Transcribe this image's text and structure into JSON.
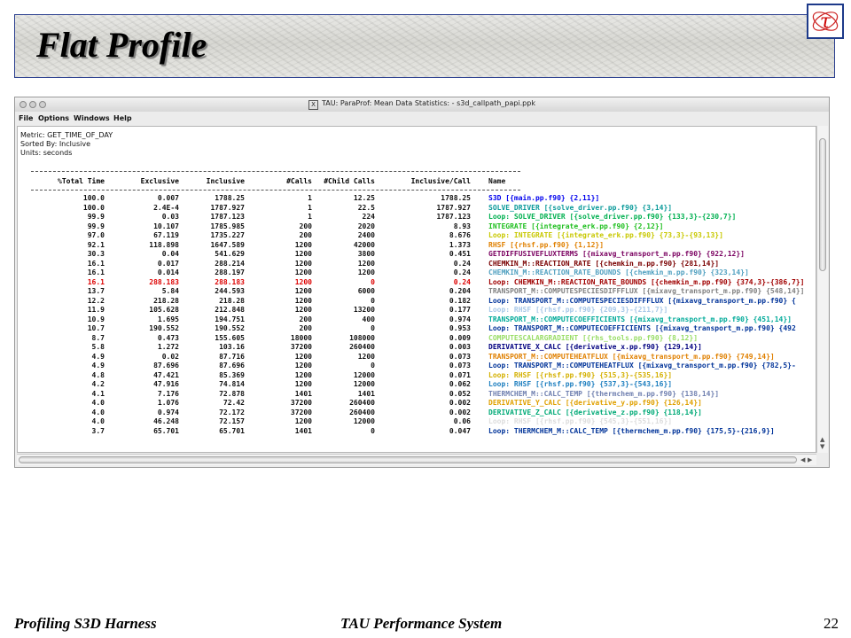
{
  "slide": {
    "title": "Flat Profile",
    "logo_glyph": "τ",
    "footer_left": "Profiling S3D Harness",
    "footer_center": "TAU Performance System",
    "page_number": "22"
  },
  "window": {
    "title": "TAU: ParaProf: Mean Data Statistics: - s3d_callpath_papi.ppk",
    "title_icon": "X",
    "menu": [
      "File",
      "Options",
      "Windows",
      "Help"
    ]
  },
  "meta": {
    "metric": "Metric: GET_TIME_OF_DAY",
    "sorted_by": "Sorted By: Inclusive",
    "units": "Units: seconds"
  },
  "table": {
    "headers": [
      "%Total Time",
      "Exclusive",
      "Inclusive",
      "#Calls",
      "#Child Calls",
      "Inclusive/Call",
      "Name"
    ],
    "rows": [
      {
        "total": "100.0",
        "exclusive": "0.007",
        "inclusive": "1788.25",
        "calls": "1",
        "child_calls": "12.25",
        "incl_per_call": "1788.25",
        "name": "S3D [{main.pp.f90} {2,11}]",
        "color": "#0000ee"
      },
      {
        "total": "100.0",
        "exclusive": "2.4E-4",
        "inclusive": "1787.927",
        "calls": "1",
        "child_calls": "22.5",
        "incl_per_call": "1787.927",
        "name": "SOLVE_DRIVER [{solve_driver.pp.f90} {3,14}]",
        "color": "#0a9a9a"
      },
      {
        "total": "99.9",
        "exclusive": "0.03",
        "inclusive": "1787.123",
        "calls": "1",
        "child_calls": "224",
        "incl_per_call": "1787.123",
        "name": "Loop: SOLVE_DRIVER [{solve_driver.pp.f90} {133,3}-{230,7}]",
        "color": "#00b050"
      },
      {
        "total": "99.9",
        "exclusive": "10.107",
        "inclusive": "1785.985",
        "calls": "200",
        "child_calls": "2020",
        "incl_per_call": "8.93",
        "name": "INTEGRATE [{integrate_erk.pp.f90} {2,12}]",
        "color": "#1fbf1f"
      },
      {
        "total": "97.0",
        "exclusive": "67.119",
        "inclusive": "1735.227",
        "calls": "200",
        "child_calls": "2400",
        "incl_per_call": "8.676",
        "name": "Loop: INTEGRATE [{integrate_erk.pp.f90} {73,3}-{93,13}]",
        "color": "#c8c800"
      },
      {
        "total": "92.1",
        "exclusive": "118.898",
        "inclusive": "1647.589",
        "calls": "1200",
        "child_calls": "42000",
        "incl_per_call": "1.373",
        "name": "RHSF [{rhsf.pp.f90} {1,12}]",
        "color": "#e08000"
      },
      {
        "total": "30.3",
        "exclusive": "0.04",
        "inclusive": "541.629",
        "calls": "1200",
        "child_calls": "3800",
        "incl_per_call": "0.451",
        "name": "GETDIFFUSIVEFLUXTERMS [{mixavg_transport_m.pp.f90} {922,12}]",
        "color": "#7a0060"
      },
      {
        "total": "16.1",
        "exclusive": "0.017",
        "inclusive": "288.214",
        "calls": "1200",
        "child_calls": "1200",
        "incl_per_call": "0.24",
        "name": "CHEMKIN_M::REACTION_RATE [{chemkin_m.pp.f90} {281,14}]",
        "color": "#7a0000"
      },
      {
        "total": "16.1",
        "exclusive": "0.014",
        "inclusive": "288.197",
        "calls": "1200",
        "child_calls": "1200",
        "incl_per_call": "0.24",
        "name": "CHEMKIN_M::REACTION_RATE_BOUNDS [{chemkin_m.pp.f90} {323,14}]",
        "color": "#50a0c0"
      },
      {
        "total": "16.1",
        "exclusive": "288.183",
        "inclusive": "288.183",
        "calls": "1200",
        "child_calls": "0",
        "incl_per_call": "0.24",
        "name": "Loop: CHEMKIN_M::REACTION_RATE_BOUNDS [{chemkin_m.pp.f90} {374,3}-{386,7}]",
        "color": "#a00000",
        "highlight": true
      },
      {
        "total": "13.7",
        "exclusive": "5.84",
        "inclusive": "244.593",
        "calls": "1200",
        "child_calls": "6000",
        "incl_per_call": "0.204",
        "name": "TRANSPORT_M::COMPUTESPECIESDIFFFLUX [{mixavg_transport_m.pp.f90} {548,14}]",
        "color": "#808080"
      },
      {
        "total": "12.2",
        "exclusive": "218.28",
        "inclusive": "218.28",
        "calls": "1200",
        "child_calls": "0",
        "incl_per_call": "0.182",
        "name": "Loop: TRANSPORT_M::COMPUTESPECIESDIFFFLUX [{mixavg_transport_m.pp.f90} {",
        "color": "#003399"
      },
      {
        "total": "11.9",
        "exclusive": "105.628",
        "inclusive": "212.848",
        "calls": "1200",
        "child_calls": "13200",
        "incl_per_call": "0.177",
        "name": "Loop: RHSF [{rhsf.pp.f90} {209,3}-{211,7}]",
        "color": "#a8c8e8"
      },
      {
        "total": "10.9",
        "exclusive": "1.695",
        "inclusive": "194.751",
        "calls": "200",
        "child_calls": "400",
        "incl_per_call": "0.974",
        "name": "TRANSPORT_M::COMPUTECOEFFICIENTS [{mixavg_transport_m.pp.f90} {451,14}]",
        "color": "#00aa99"
      },
      {
        "total": "10.7",
        "exclusive": "190.552",
        "inclusive": "190.552",
        "calls": "200",
        "child_calls": "0",
        "incl_per_call": "0.953",
        "name": "Loop: TRANSPORT_M::COMPUTECOEFFICIENTS [{mixavg_transport_m.pp.f90} {492",
        "color": "#003399"
      },
      {
        "total": "8.7",
        "exclusive": "0.473",
        "inclusive": "155.605",
        "calls": "18000",
        "child_calls": "108000",
        "incl_per_call": "0.009",
        "name": "COMPUTESCALARGRADIENT [{rhs_tools.pp.f90} {8,12}]",
        "color": "#99dd66"
      },
      {
        "total": "5.8",
        "exclusive": "1.272",
        "inclusive": "103.16",
        "calls": "37200",
        "child_calls": "260400",
        "incl_per_call": "0.003",
        "name": "DERIVATIVE_X_CALC [{derivative_x.pp.f90} {129,14}]",
        "color": "#000080"
      },
      {
        "total": "4.9",
        "exclusive": "0.02",
        "inclusive": "87.716",
        "calls": "1200",
        "child_calls": "1200",
        "incl_per_call": "0.073",
        "name": "TRANSPORT_M::COMPUTEHEATFLUX [{mixavg_transport_m.pp.f90} {749,14}]",
        "color": "#e08000"
      },
      {
        "total": "4.9",
        "exclusive": "87.696",
        "inclusive": "87.696",
        "calls": "1200",
        "child_calls": "0",
        "incl_per_call": "0.073",
        "name": "Loop: TRANSPORT_M::COMPUTEHEATFLUX [{mixavg_transport_m.pp.f90} {782,5}-",
        "color": "#003399"
      },
      {
        "total": "4.8",
        "exclusive": "47.421",
        "inclusive": "85.369",
        "calls": "1200",
        "child_calls": "12000",
        "incl_per_call": "0.071",
        "name": "Loop: RHSF [{rhsf.pp.f90} {515,3}-{535,16}]",
        "color": "#d4b000"
      },
      {
        "total": "4.2",
        "exclusive": "47.916",
        "inclusive": "74.814",
        "calls": "1200",
        "child_calls": "12000",
        "incl_per_call": "0.062",
        "name": "Loop: RHSF [{rhsf.pp.f90} {537,3}-{543,16}]",
        "color": "#2080c0"
      },
      {
        "total": "4.1",
        "exclusive": "7.176",
        "inclusive": "72.878",
        "calls": "1401",
        "child_calls": "1401",
        "incl_per_call": "0.052",
        "name": "THERMCHEM_M::CALC_TEMP [{thermchem_m.pp.f90} {138,14}]",
        "color": "#7080b0"
      },
      {
        "total": "4.0",
        "exclusive": "1.076",
        "inclusive": "72.42",
        "calls": "37200",
        "child_calls": "260400",
        "incl_per_call": "0.002",
        "name": "DERIVATIVE_Y_CALC [{derivative_y.pp.f90} {126,14}]",
        "color": "#e0a000"
      },
      {
        "total": "4.0",
        "exclusive": "0.974",
        "inclusive": "72.172",
        "calls": "37200",
        "child_calls": "260400",
        "incl_per_call": "0.002",
        "name": "DERIVATIVE_Z_CALC [{derivative_z.pp.f90} {118,14}]",
        "color": "#00aa77"
      },
      {
        "total": "4.0",
        "exclusive": "46.248",
        "inclusive": "72.157",
        "calls": "1200",
        "child_calls": "12000",
        "incl_per_call": "0.06",
        "name": "Loop: RHSF [{rhsf.pp.f90} {545,3}-{551,16}]",
        "color": "#dddddd"
      },
      {
        "total": "3.7",
        "exclusive": "65.701",
        "inclusive": "65.701",
        "calls": "1401",
        "child_calls": "0",
        "incl_per_call": "0.047",
        "name": "Loop: THERMCHEM_M::CALC_TEMP [{thermchem_m.pp.f90} {175,5}-{216,9}]",
        "color": "#003399"
      }
    ]
  }
}
